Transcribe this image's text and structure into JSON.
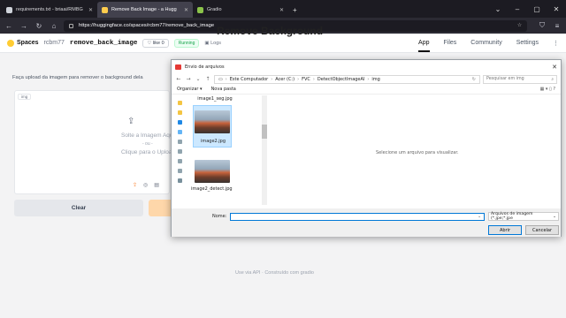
{
  "browser": {
    "tabs": [
      {
        "title": "requirements.txt - briaai/RMBG",
        "active": false,
        "icon": "file-icon"
      },
      {
        "title": "Remove Back Image - a Hugg",
        "active": true,
        "icon": "huggingface-icon"
      },
      {
        "title": "Gradio",
        "active": false,
        "icon": "gradio-icon"
      }
    ],
    "url": "https://huggingface.co/spaces/rcbm77/remove_back_image"
  },
  "hf": {
    "spaces_label": "Spaces",
    "user": "rcbm77",
    "repo": "remove_back_image",
    "like_label": "like",
    "like_count": "0",
    "status": "Running",
    "logs_label": "Logs",
    "nav": {
      "app": "App",
      "files": "Files",
      "community": "Community",
      "settings": "Settings"
    }
  },
  "app": {
    "title": "Remove Background",
    "subtitle": "Faça upload da imagem para remover o background dela",
    "upload_label": "img",
    "drop_text": "Solte a Imagem Aqui",
    "or_text": "- ou -",
    "click_text": "Clique para o Upload",
    "clear_label": "Clear",
    "footer": "Use via API  ·  Construído com gradio"
  },
  "dialog": {
    "title": "Envio de arquivos",
    "path": [
      "Este Computador",
      "Acer (C:)",
      "FVC",
      "DetectObjectImageAI",
      "img"
    ],
    "search_placeholder": "Pesquisar em img",
    "organize_label": "Organizar",
    "new_folder_label": "Nova pasta",
    "files": [
      {
        "name": "image1_seg.jpg"
      },
      {
        "name": "image2.jpg"
      },
      {
        "name": "image2_detect.jpg"
      }
    ],
    "preview_message": "Selecione um arquivo para visualizar.",
    "name_label": "Nome:",
    "name_value": "",
    "file_type": "Arquivos de imagem (*.jpe;*.jpe",
    "open_label": "Abrir",
    "cancel_label": "Cancelar"
  },
  "colors": {
    "accent": "#0078d7",
    "running": "#16a34a",
    "submit": "#fed7aa"
  }
}
